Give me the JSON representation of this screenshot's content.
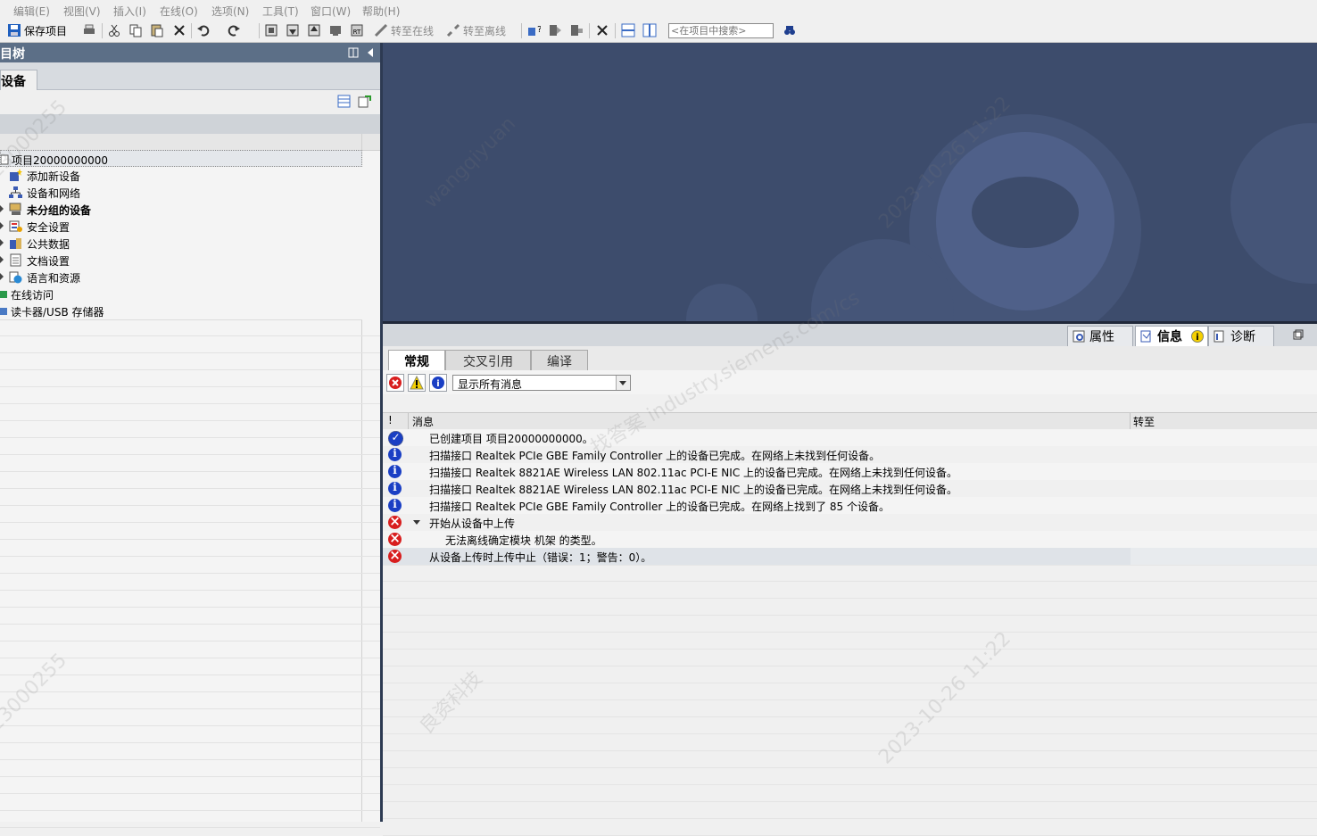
{
  "menu": [
    "编辑(E)",
    "视图(V)",
    "插入(I)",
    "在线(O)",
    "选项(N)",
    "工具(T)",
    "窗口(W)",
    "帮助(H)"
  ],
  "toolbar": {
    "save_label": "保存项目",
    "go_online_label": "转至在线",
    "go_offline_label": "转至离线",
    "search_placeholder": "<在项目中搜索>"
  },
  "project_tree": {
    "title": "目树",
    "tab": "设备",
    "items": [
      {
        "label": "项目20000000000",
        "icon": "project-icon",
        "bold": false
      },
      {
        "label": "添加新设备",
        "icon": "add-device-icon",
        "bold": false
      },
      {
        "label": "设备和网络",
        "icon": "network-icon",
        "bold": false
      },
      {
        "label": "未分组的设备",
        "icon": "ungrouped-devices-icon",
        "bold": true
      },
      {
        "label": "安全设置",
        "icon": "security-icon",
        "bold": false
      },
      {
        "label": "公共数据",
        "icon": "common-data-icon",
        "bold": false
      },
      {
        "label": "文档设置",
        "icon": "document-settings-icon",
        "bold": false
      },
      {
        "label": "语言和资源",
        "icon": "language-icon",
        "bold": false
      },
      {
        "label": "在线访问",
        "icon": "online-access-icon",
        "bold": false
      },
      {
        "label": "读卡器/USB 存储器",
        "icon": "card-reader-icon",
        "bold": false
      }
    ]
  },
  "inspector": {
    "tabs": [
      "属性",
      "信息",
      "诊断"
    ],
    "subtabs": [
      "常规",
      "交叉引用",
      "编译"
    ],
    "filter_value": "显示所有消息",
    "columns": {
      "flag": "!",
      "message": "消息",
      "goto": "转至"
    },
    "messages": [
      {
        "type": "ok",
        "indent": 0,
        "text": "已创建项目 项目20000000000。"
      },
      {
        "type": "info",
        "indent": 0,
        "text": "扫描接口 Realtek PCIe GBE Family Controller 上的设备已完成。在网络上未找到任何设备。"
      },
      {
        "type": "info",
        "indent": 0,
        "text": "扫描接口 Realtek 8821AE Wireless LAN 802.11ac PCI-E NIC 上的设备已完成。在网络上未找到任何设备。"
      },
      {
        "type": "info",
        "indent": 0,
        "text": "扫描接口 Realtek 8821AE Wireless LAN 802.11ac PCI-E NIC 上的设备已完成。在网络上未找到任何设备。"
      },
      {
        "type": "info",
        "indent": 0,
        "text": "扫描接口 Realtek PCIe GBE Family Controller 上的设备已完成。在网络上找到了 85 个设备。"
      },
      {
        "type": "err",
        "indent": 0,
        "text": "开始从设备中上传",
        "expanded": true
      },
      {
        "type": "err",
        "indent": 1,
        "text": "无法离线确定模块 机架 的类型。"
      },
      {
        "type": "err",
        "indent": 0,
        "text": "从设备上传时上传中止（错误：1；警告：0）。",
        "selected": true
      }
    ]
  },
  "watermark": {
    "lines": [
      "lc23000255",
      "wangqiyuan",
      "良资科技",
      "2023-10-26 11:22"
    ],
    "site": "找答案 industry.siemens.com/cs"
  },
  "colors": {
    "title_bar": "#5c6f87",
    "work_area": "#3d4c6c",
    "info_blue": "#1a3fc4",
    "error_red": "#d81e1e"
  }
}
